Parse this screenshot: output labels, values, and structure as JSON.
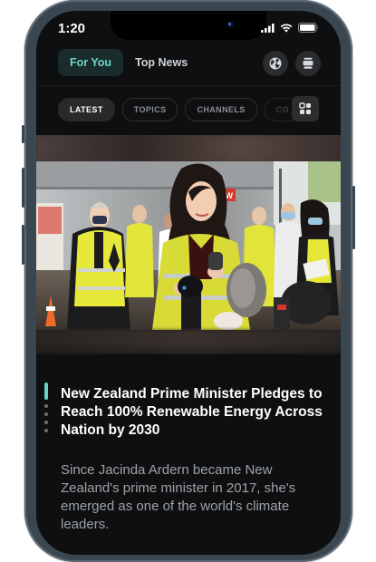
{
  "status_bar": {
    "time": "1:20"
  },
  "header": {
    "tabs": [
      {
        "label": "For You",
        "active": true
      },
      {
        "label": "Top News",
        "active": false
      }
    ],
    "icons": [
      "globe-icon",
      "cards-icon"
    ]
  },
  "categories": {
    "chips": [
      {
        "label": "LATEST",
        "active": true
      },
      {
        "label": "TOPICS",
        "active": false
      },
      {
        "label": "CHANNELS",
        "active": false
      },
      {
        "label": "CO",
        "active": false
      }
    ],
    "view_toggle_icon": "grid-icon"
  },
  "article": {
    "headline": "New Zealand Prime Minister Pledges to Reach 100% Renewable Energy Across Nation by 2030",
    "summary": "Since Jacinda Ardern became New Zealand's prime minister in 2017, she's emerged as one of the world's climate leaders.",
    "sign_text": "NEW"
  },
  "pager": {
    "current": 1,
    "total": 5
  },
  "colors": {
    "accent": "#6fd1c6",
    "background": "#0e0f10"
  }
}
